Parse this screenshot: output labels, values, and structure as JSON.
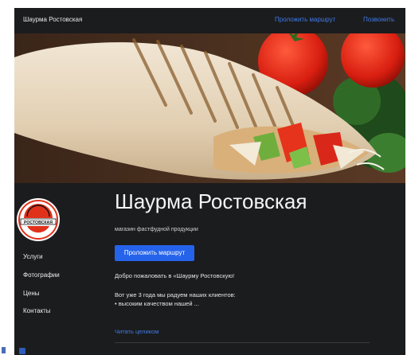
{
  "header": {
    "brand": "Шаурма Ростовская",
    "nav": {
      "route": "Проложить маршрут",
      "call": "Позвонить"
    }
  },
  "hero": {
    "image": "shawarma-photo"
  },
  "logo": {
    "text": "РОСТОВСКАЯ"
  },
  "sidebar": {
    "items": [
      {
        "label": "Услуги"
      },
      {
        "label": "Фотографии"
      },
      {
        "label": "Цены"
      },
      {
        "label": "Контакты"
      }
    ]
  },
  "main": {
    "title": "Шаурма Ростовская",
    "subtitle": "магазин фастфудной продукции",
    "cta_label": "Проложить маршрут",
    "welcome": "Добро пожаловать в «Шаурму Ростовскую!",
    "paragraph_line1": "Вот уже 3 года мы радуем наших клиентов:",
    "paragraph_line2": "• высоким качеством нашей ...",
    "read_more": "Читать целиком"
  },
  "colors": {
    "background": "#1b1c1e",
    "accent": "#2563eb",
    "link": "#3f7ae8"
  }
}
